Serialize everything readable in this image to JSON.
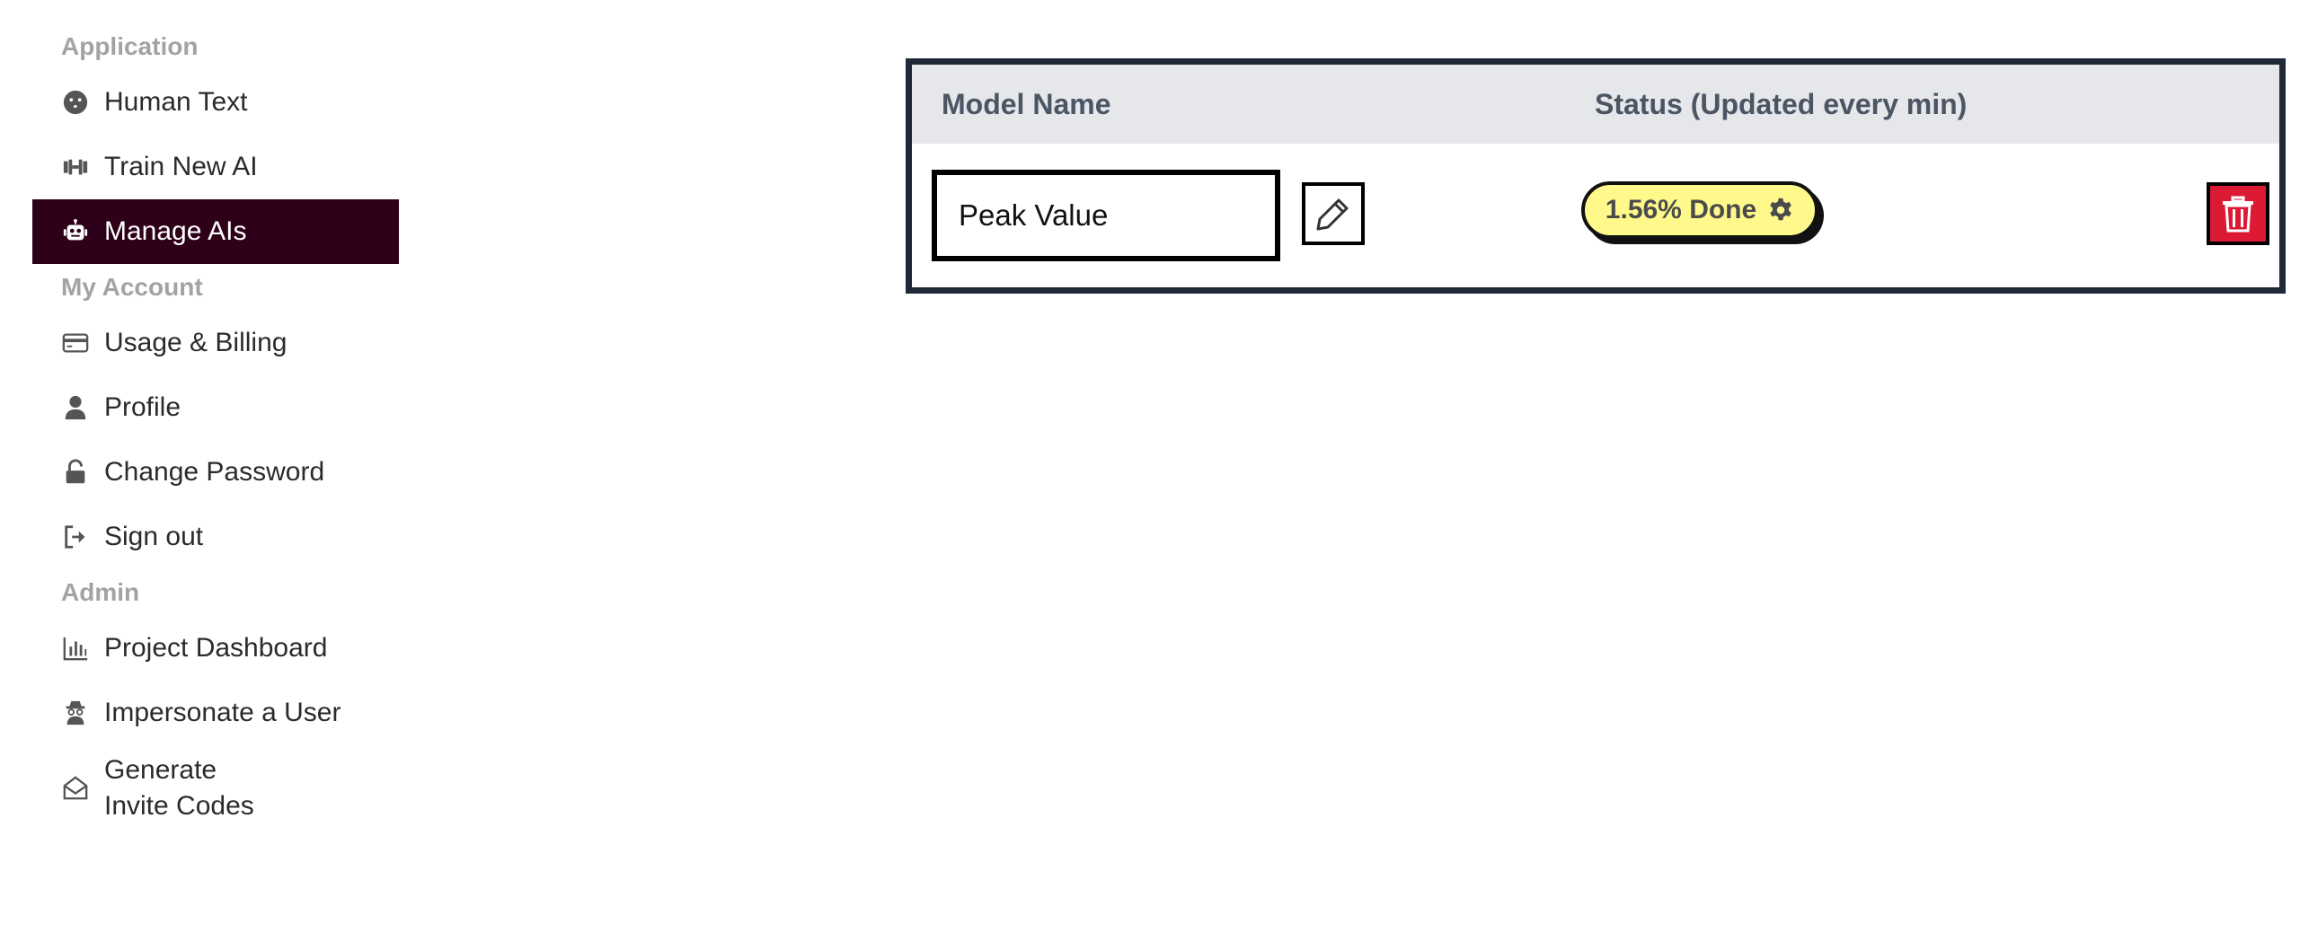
{
  "sidebar": {
    "sections": [
      {
        "title": "Application",
        "items": [
          {
            "label": "Human Text",
            "icon": "kiss-face-icon"
          },
          {
            "label": "Train New AI",
            "icon": "dumbbell-icon"
          },
          {
            "label": "Manage AIs",
            "icon": "robot-icon",
            "active": true
          }
        ]
      },
      {
        "title": "My Account",
        "items": [
          {
            "label": "Usage & Billing",
            "icon": "credit-card-icon"
          },
          {
            "label": "Profile",
            "icon": "user-icon"
          },
          {
            "label": "Change Password",
            "icon": "unlock-icon"
          },
          {
            "label": "Sign out",
            "icon": "sign-out-icon"
          }
        ]
      },
      {
        "title": "Admin",
        "items": [
          {
            "label": "Project Dashboard",
            "icon": "bar-chart-icon"
          },
          {
            "label": "Impersonate a User",
            "icon": "spy-icon"
          },
          {
            "label": "Generate\nInvite Codes",
            "icon": "envelope-open-icon"
          }
        ]
      }
    ]
  },
  "table": {
    "headers": {
      "model_name": "Model Name",
      "status": "Status (Updated every min)"
    },
    "rows": [
      {
        "model_name": "Peak Value",
        "status": "1.56% Done"
      }
    ]
  },
  "colors": {
    "active_nav_bg": "#2e0019",
    "status_pill_bg": "#fef98a",
    "delete_button_bg": "#dc1a34",
    "table_border": "#1f2937",
    "table_header_bg": "#e5e7eb"
  }
}
